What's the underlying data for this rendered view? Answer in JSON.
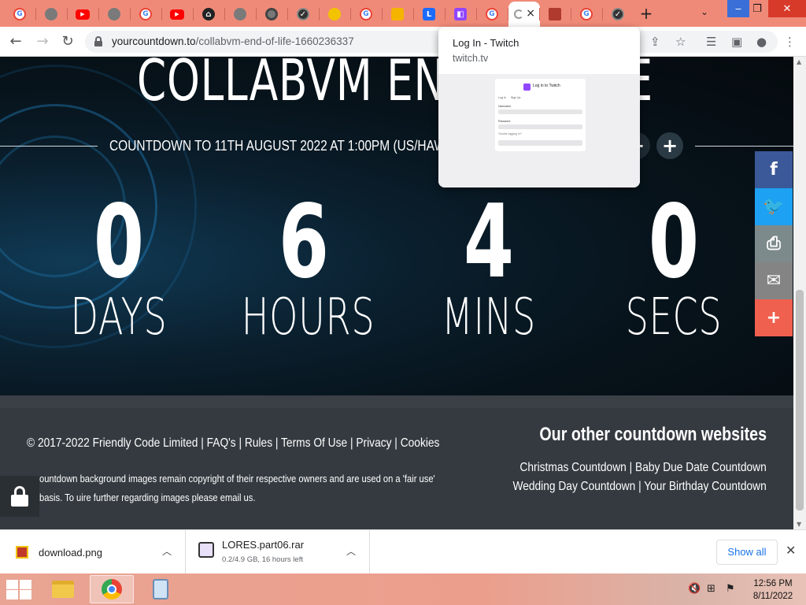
{
  "browser": {
    "url_domain": "yourcountdown.to",
    "url_path": "/collabvm-end-of-life-1660236337",
    "tabs": [
      {
        "icon": "google-icon",
        "letter": "G",
        "style": "g"
      },
      {
        "icon": "globe-icon",
        "letter": "",
        "style": "globe"
      },
      {
        "icon": "youtube-icon",
        "letter": "▶",
        "style": "yt"
      },
      {
        "icon": "globe-icon",
        "letter": "",
        "style": "globe"
      },
      {
        "icon": "google-icon",
        "letter": "G",
        "style": "g"
      },
      {
        "icon": "youtube-icon",
        "letter": "▶",
        "style": "yt"
      },
      {
        "icon": "home-icon",
        "letter": "⌂",
        "style": "dark"
      },
      {
        "icon": "globe-icon",
        "letter": "",
        "style": "globe"
      },
      {
        "icon": "chrome-icon",
        "letter": "",
        "style": "chrome"
      },
      {
        "icon": "check-circle-icon",
        "letter": "✓",
        "style": "circ"
      },
      {
        "icon": "yellow-circle-icon",
        "letter": "",
        "style": "yellow"
      },
      {
        "icon": "google-icon",
        "letter": "G",
        "style": "g"
      },
      {
        "icon": "mail-icon",
        "letter": "",
        "style": "mail"
      },
      {
        "icon": "blue-app-icon",
        "letter": "L",
        "style": "blue"
      },
      {
        "icon": "twitch-icon",
        "letter": "◧",
        "style": "twitch"
      },
      {
        "icon": "google-icon",
        "letter": "G",
        "style": "g"
      },
      {
        "icon": "loading-icon",
        "letter": "",
        "style": "active"
      },
      {
        "icon": "image-icon",
        "letter": "",
        "style": "img"
      },
      {
        "icon": "google-icon",
        "letter": "G",
        "style": "g"
      },
      {
        "icon": "check-circle-icon",
        "letter": "✓",
        "style": "circ"
      }
    ],
    "new_tab_label": "+",
    "close_tab_glyph": "×",
    "tab_search_glyph": "⌄"
  },
  "hovercard": {
    "title": "Log In - Twitch",
    "domain": "twitch.tv",
    "preview": {
      "heading": "Log in to Twitch",
      "tab_login": "Log In",
      "tab_signup": "Sign Up",
      "username_label": "Username",
      "password_label": "Password",
      "trouble_label": "Trouble logging in?",
      "login_button": "Log In"
    }
  },
  "hero": {
    "title": "COLLABVM END OF LIFE",
    "subtitle": "COUNTDOWN TO 11TH AUGUST 2022 AT 1:00PM (US/HAWAII TIME)",
    "plus_glyph": "+"
  },
  "countdown": [
    {
      "value": "0",
      "unit": "DAYS"
    },
    {
      "value": "6",
      "unit": "HOURS"
    },
    {
      "value": "4",
      "unit": "MINS"
    },
    {
      "value": "0",
      "unit": "SECS"
    }
  ],
  "share": [
    {
      "icon": "facebook-icon",
      "glyph": "f",
      "color": "#3b5998"
    },
    {
      "icon": "twitter-icon",
      "glyph": "🐦",
      "color": "#1da1f2"
    },
    {
      "icon": "print-icon",
      "glyph": "⎙",
      "color": "#7d8a8c"
    },
    {
      "icon": "email-icon",
      "glyph": "✉",
      "color": "#848484"
    },
    {
      "icon": "more-icon",
      "glyph": "+",
      "color": "#f0604f"
    }
  ],
  "footer": {
    "copyright": "© 2017-2022 Friendly Code Limited | FAQ's | Rules | Terms Of Use | Privacy | Cookies",
    "disclaimer": "ountdown background images remain copyright of their respective owners and are used on a 'fair use' basis. To uire further regarding images please email us.",
    "other_title": "Our other countdown websites",
    "other_line1": "Christmas Countdown | Baby Due Date Countdown",
    "other_line2": "Wedding Day Countdown | Your Birthday Countdown"
  },
  "downloads": {
    "items": [
      {
        "name": "download.png",
        "status": ""
      },
      {
        "name": "LORES.part06.rar",
        "status": "0.2/4.9 GB, 16 hours left"
      }
    ],
    "show_all": "Show all",
    "close_glyph": "✕"
  },
  "taskbar": {
    "time": "12:56 PM",
    "date": "8/11/2022"
  },
  "colors": {
    "tabstrip": "#f08a78",
    "footer": "#343a40",
    "link_blue": "#1a73e8"
  }
}
